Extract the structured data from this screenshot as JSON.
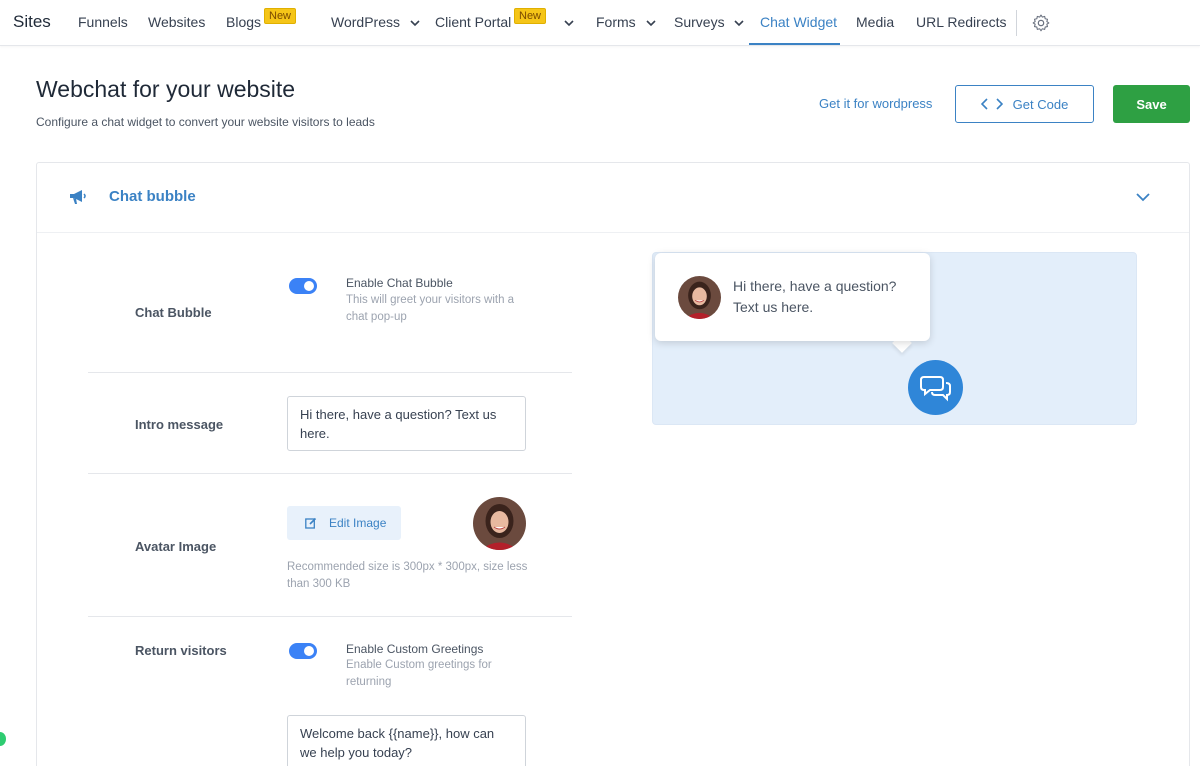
{
  "nav": {
    "brand": "Sites",
    "items": [
      {
        "label": "Funnels"
      },
      {
        "label": "Websites"
      },
      {
        "label": "Blogs",
        "badge": "New"
      },
      {
        "label": "WordPress"
      },
      {
        "label": "Client Portal",
        "badge": "New"
      },
      {
        "label": "Forms"
      },
      {
        "label": "Surveys"
      },
      {
        "label": "Chat Widget"
      },
      {
        "label": "Media"
      },
      {
        "label": "URL Redirects"
      }
    ],
    "active": "Chat Widget"
  },
  "header": {
    "title": "Webchat for your website",
    "subtitle": "Configure a chat widget to convert your website visitors to leads",
    "wordpress_link": "Get it for wordpress",
    "get_code_label": "Get Code",
    "save_label": "Save"
  },
  "card": {
    "title": "Chat bubble",
    "chat_bubble": {
      "label": "Chat Bubble",
      "toggle_on": true,
      "option_title": "Enable Chat Bubble",
      "option_desc": "This will greet your visitors with a chat pop-up"
    },
    "intro_message": {
      "label": "Intro message",
      "value": "Hi there, have a question? Text us here."
    },
    "avatar_image": {
      "label": "Avatar Image",
      "edit_label": "Edit Image",
      "recommendation": "Recommended size is 300px * 300px, size less than 300 KB"
    },
    "return_visitors": {
      "label": "Return visitors",
      "toggle_on": true,
      "option_title": "Enable Custom Greetings",
      "option_desc": "Enable Custom greetings for returning",
      "greeting_value": "Welcome back {{name}}, how can we help you today?"
    }
  },
  "preview": {
    "message": "Hi there, have a question? Text us here."
  },
  "colors": {
    "accent": "#3b82c4",
    "save_green": "#2ea043",
    "toggle_blue": "#3b82f6",
    "preview_bg": "#e3eefa",
    "badge_yellow": "#f5c518"
  }
}
